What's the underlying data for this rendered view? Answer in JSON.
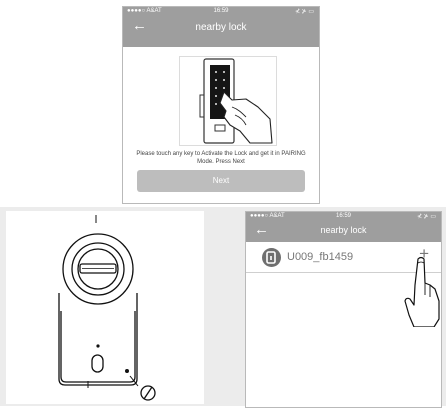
{
  "top_screen": {
    "status": {
      "carrier": "●●●●○ A&AT",
      "time": "16:59",
      "battery": "⊀ ⊁ ▭"
    },
    "title": "nearby lock",
    "back_icon": "back-arrow-icon",
    "instruction": "Please touch any key to Activate the Lock and get it in PAIRING Mode. Press Next",
    "next_label": "Next"
  },
  "bottom_screen": {
    "status": {
      "carrier": "●●●●○ A&AT",
      "time": "16:59",
      "battery": "⊀ ⊁ ▭"
    },
    "title": "nearby lock",
    "back_icon": "back-arrow-icon",
    "lock_name": "U009_fb1459",
    "add_label": "+"
  },
  "colors": {
    "navbar": "#9e9e9e",
    "button": "#bdbdbd",
    "background_band": "#ececec"
  }
}
